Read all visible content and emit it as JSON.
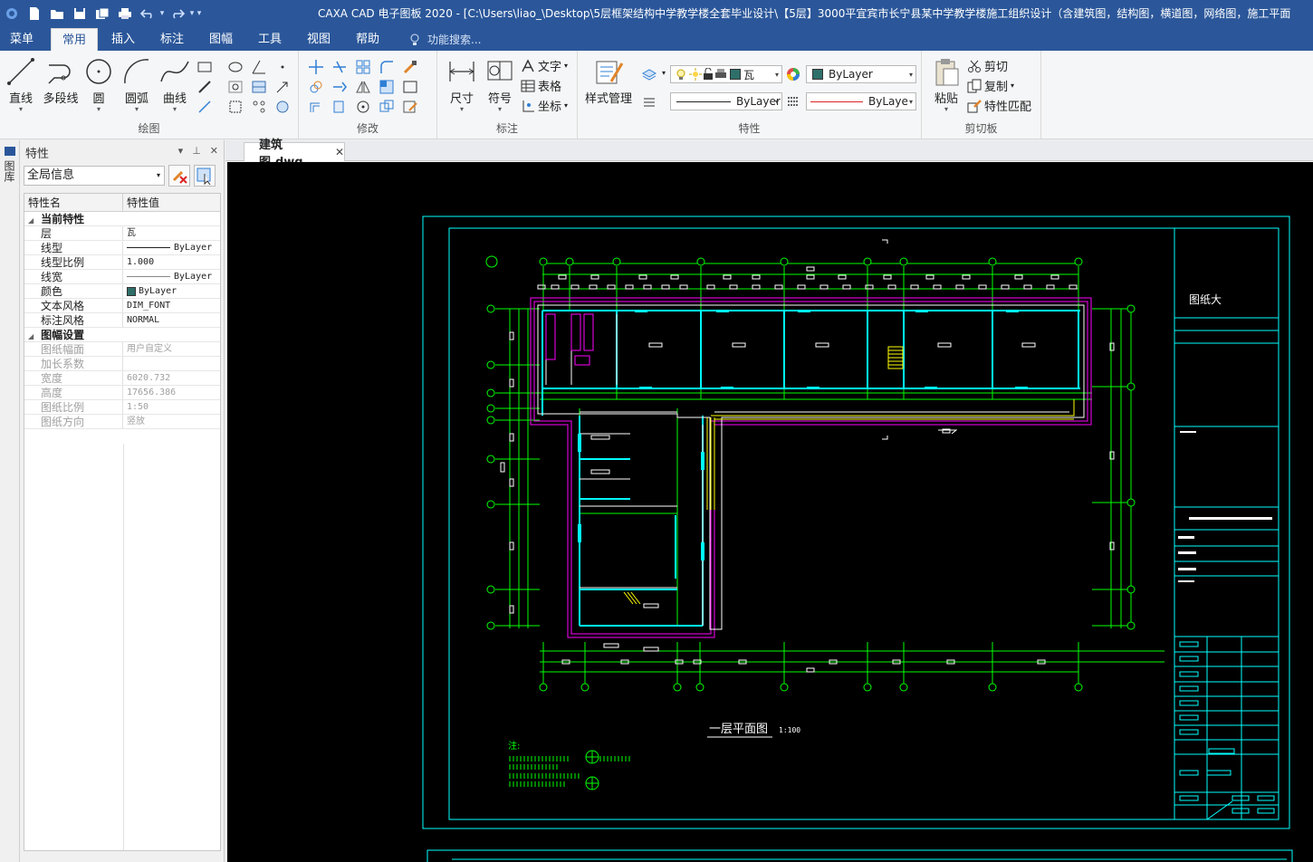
{
  "app": {
    "title": "CAXA CAD 电子图板 2020 - [C:\\Users\\liao_\\Desktop\\5层框架结构中学教学楼全套毕业设计\\【5层】3000平宜宾市长宁县某中学教学楼施工组织设计（含建筑图，结构图，横道图，网络图，施工平面"
  },
  "menu_tabs": [
    "菜单",
    "常用",
    "插入",
    "标注",
    "图幅",
    "工具",
    "视图",
    "帮助"
  ],
  "active_tab": "常用",
  "search_placeholder": "功能搜索...",
  "ribbon": {
    "draw": {
      "label": "绘图",
      "line": "直线",
      "polyline": "多段线",
      "circle": "圆",
      "arc": "圆弧",
      "curve": "曲线"
    },
    "modify": {
      "label": "修改"
    },
    "annotate": {
      "label": "标注",
      "dimension": "尺寸",
      "symbol": "符号",
      "text": "文字",
      "table": "表格",
      "coordinate": "坐标"
    },
    "properties": {
      "label": "特性",
      "style_manager": "样式管理",
      "layer_value": "瓦",
      "color_value": "ByLayer",
      "linetype_value": "ByLayer",
      "lineweight_value": "ByLaye"
    },
    "clipboard": {
      "label": "剪切板",
      "paste": "粘贴",
      "cut": "剪切",
      "copy": "复制",
      "match": "特性匹配"
    }
  },
  "side_strip": {
    "label": "图库"
  },
  "panel": {
    "title": "特性",
    "selector": "全局信息",
    "col_name": "特性名",
    "col_value": "特性值",
    "cat_current": "当前特性",
    "cat_sheet": "图幅设置",
    "rows_current": [
      {
        "name": "层",
        "value": "瓦"
      },
      {
        "name": "线型",
        "value": "ByLayer"
      },
      {
        "name": "线型比例",
        "value": "1.000"
      },
      {
        "name": "线宽",
        "value": "ByLayer"
      },
      {
        "name": "颜色",
        "value": "ByLayer"
      },
      {
        "name": "文本风格",
        "value": "DIM_FONT"
      },
      {
        "name": "标注风格",
        "value": "NORMAL"
      }
    ],
    "rows_sheet": [
      {
        "name": "图纸幅面",
        "value": "用户自定义"
      },
      {
        "name": "加长系数",
        "value": ""
      },
      {
        "name": "宽度",
        "value": "6020.732"
      },
      {
        "name": "高度",
        "value": "17656.386"
      },
      {
        "name": "图纸比例",
        "value": "1:50"
      },
      {
        "name": "图纸方向",
        "value": "竖放"
      }
    ]
  },
  "document": {
    "tab_label": "建筑图.dwg",
    "plan_title": "一层平面图",
    "plan_scale": "1:100",
    "note_label": "注:",
    "title_block_name": "图纸大",
    "colors": {
      "background": "#000000",
      "axis": "#00ff00",
      "wall": "#00ffff",
      "frame": "#00ffff",
      "outline": "#ff00ff",
      "text": "#ffffff",
      "stair": "#ffff00"
    }
  }
}
